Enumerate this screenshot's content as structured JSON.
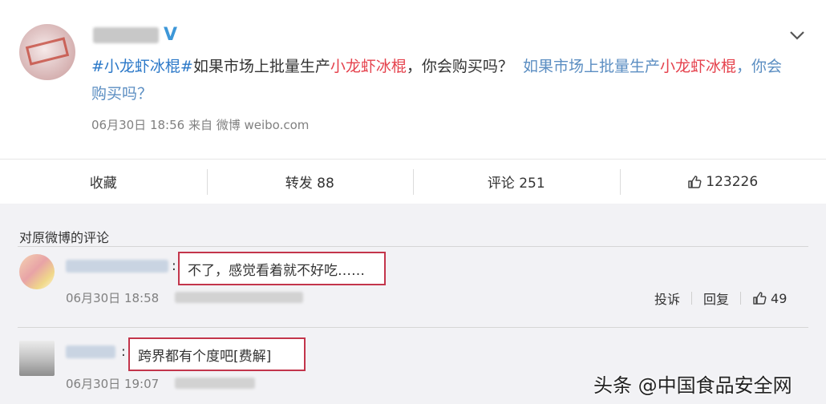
{
  "post": {
    "tag": "#小龙虾冰棍#",
    "text_part1": "如果市场上批量生产",
    "keyword": "小龙虾冰棍",
    "text_part2": "，你会购买吗？",
    "link_part1": "如果市场上批量生产",
    "link_keyword": "小龙虾冰棍",
    "link_part2": "，你会购买吗？",
    "meta": "06月30日 18:56  来自 微博 weibo.com"
  },
  "actions": {
    "favorite": "收藏",
    "repost": "转发 88",
    "comment": "评论 251",
    "like": "123226"
  },
  "comments_section": {
    "title": "对原微博的评论",
    "items": [
      {
        "text": "不了，感觉看着就不好吃……",
        "time": "06月30日 18:58",
        "report": "投诉",
        "reply": "回复",
        "likes": "49"
      },
      {
        "text": "跨界都有个度吧[费解]",
        "time": "06月30日 19:07"
      }
    ]
  },
  "watermark": "头条 @中国食品安全网",
  "colors": {
    "hashtag": "#2b78c8",
    "keyword": "#e5424d",
    "highlight_box": "#c3354b",
    "verified": "#3d97d8"
  }
}
